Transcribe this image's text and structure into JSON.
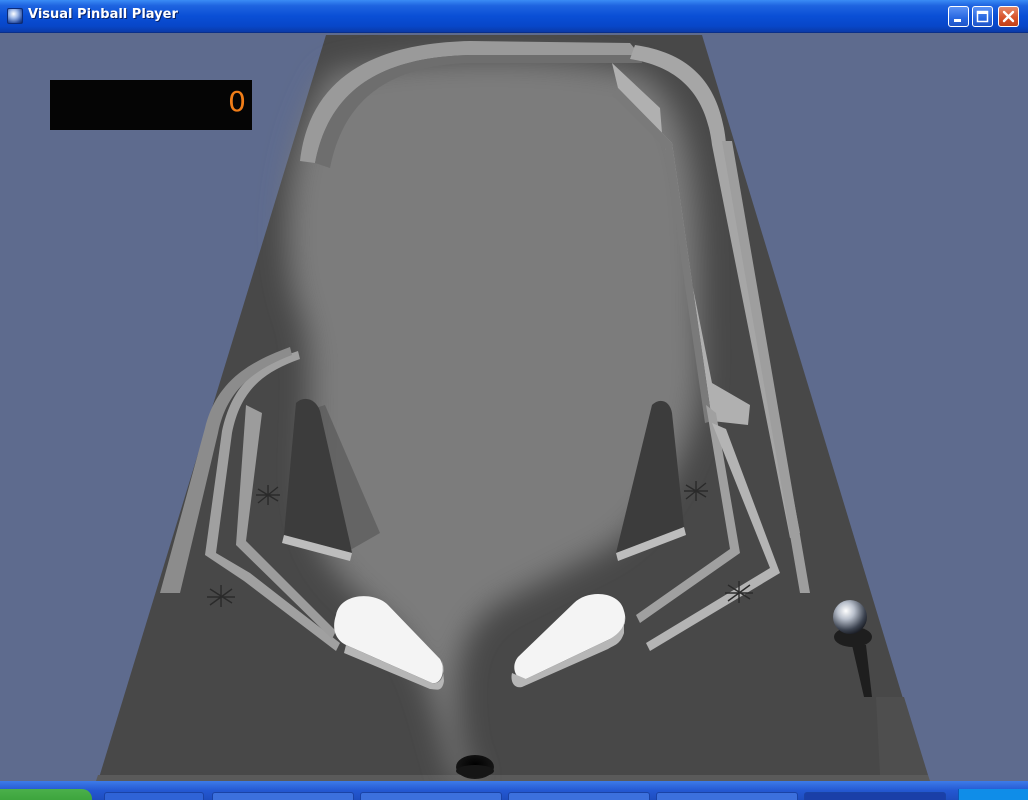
{
  "window": {
    "title": "Visual Pinball Player",
    "icon": "pinball-app-icon",
    "controls": [
      "minimize-icon",
      "maximize-icon",
      "close-icon"
    ]
  },
  "scoreboard": {
    "score": "0",
    "text_color": "#f07d18",
    "background": "#050505"
  },
  "playfield": {
    "background_color": "#5e6b8e",
    "table_dark": "#4a4a4a",
    "table_light": "#7a7a7a",
    "elements": [
      "left-flipper",
      "right-flipper",
      "left-slingshot",
      "right-slingshot",
      "pinball",
      "plunger",
      "drain-hole",
      "rollover-star-left",
      "rollover-star-right"
    ]
  },
  "taskbar": {
    "icons": [
      "start-button-icon",
      "taskbar-item-icon"
    ]
  }
}
